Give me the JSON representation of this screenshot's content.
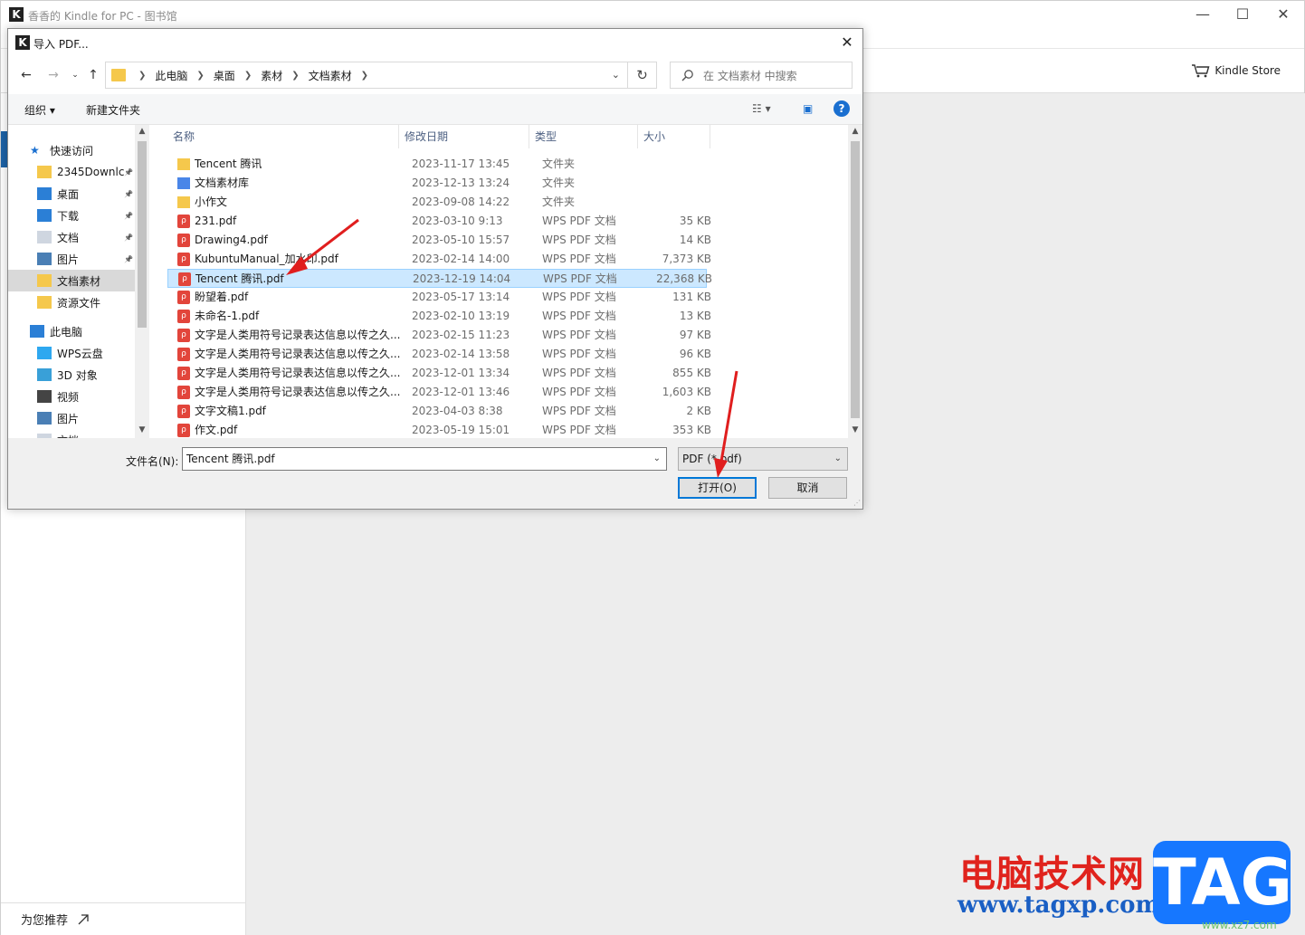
{
  "kindle": {
    "window_title": "香香的 Kindle for PC - 图书馆",
    "store_label": "Kindle Store",
    "recommend_label": "为您推荐",
    "icons": {
      "store": "cart-icon",
      "recommend": "external-link-icon"
    }
  },
  "dialog": {
    "title": "导入 PDF...",
    "breadcrumb": [
      "此电脑",
      "桌面",
      "素材",
      "文档素材"
    ],
    "search_placeholder": "在 文档素材 中搜索",
    "organize_label": "组织 ▾",
    "new_folder_label": "新建文件夹",
    "columns": [
      "名称",
      "修改日期",
      "类型",
      "大小"
    ],
    "nav": [
      {
        "label": "快速访问",
        "icon": "star-icon",
        "pinned": false
      },
      {
        "label": "2345Downlc",
        "icon": "folder-icon",
        "pinned": true
      },
      {
        "label": "桌面",
        "icon": "desktop-icon",
        "pinned": true
      },
      {
        "label": "下载",
        "icon": "download-icon",
        "pinned": true
      },
      {
        "label": "文档",
        "icon": "document-icon",
        "pinned": true
      },
      {
        "label": "图片",
        "icon": "pictures-icon",
        "pinned": true
      },
      {
        "label": "文档素材",
        "icon": "folder-icon",
        "pinned": false,
        "selected": true
      },
      {
        "label": "资源文件",
        "icon": "folder-icon",
        "pinned": false
      },
      {
        "label": "此电脑",
        "icon": "computer-icon",
        "pinned": false
      },
      {
        "label": "WPS云盘",
        "icon": "cloud-icon",
        "pinned": false
      },
      {
        "label": "3D 对象",
        "icon": "cube-icon",
        "pinned": false
      },
      {
        "label": "视频",
        "icon": "video-icon",
        "pinned": false
      },
      {
        "label": "图片",
        "icon": "pictures-icon",
        "pinned": false
      },
      {
        "label": "文档",
        "icon": "document-icon",
        "pinned": false
      }
    ],
    "files": [
      {
        "name": "Tencent 腾讯",
        "date": "2023-11-17 13:45",
        "type": "文件夹",
        "size": "",
        "kind": "folder"
      },
      {
        "name": "文档素材库",
        "date": "2023-12-13 13:24",
        "type": "文件夹",
        "size": "",
        "kind": "lib"
      },
      {
        "name": "小作文",
        "date": "2023-09-08 14:22",
        "type": "文件夹",
        "size": "",
        "kind": "folder"
      },
      {
        "name": "231.pdf",
        "date": "2023-03-10 9:13",
        "type": "WPS PDF 文档",
        "size": "35 KB",
        "kind": "pdf"
      },
      {
        "name": "Drawing4.pdf",
        "date": "2023-05-10 15:57",
        "type": "WPS PDF 文档",
        "size": "14 KB",
        "kind": "pdf"
      },
      {
        "name": "KubuntuManual_加水印.pdf",
        "date": "2023-02-14 14:00",
        "type": "WPS PDF 文档",
        "size": "7,373 KB",
        "kind": "pdf"
      },
      {
        "name": "Tencent 腾讯.pdf",
        "date": "2023-12-19 14:04",
        "type": "WPS PDF 文档",
        "size": "22,368 KB",
        "kind": "pdf",
        "selected": true
      },
      {
        "name": "盼望着.pdf",
        "date": "2023-05-17 13:14",
        "type": "WPS PDF 文档",
        "size": "131 KB",
        "kind": "pdf"
      },
      {
        "name": "未命名-1.pdf",
        "date": "2023-02-10 13:19",
        "type": "WPS PDF 文档",
        "size": "13 KB",
        "kind": "pdf"
      },
      {
        "name": "文字是人类用符号记录表达信息以传之久...",
        "date": "2023-02-15 11:23",
        "type": "WPS PDF 文档",
        "size": "97 KB",
        "kind": "pdf"
      },
      {
        "name": "文字是人类用符号记录表达信息以传之久...",
        "date": "2023-02-14 13:58",
        "type": "WPS PDF 文档",
        "size": "96 KB",
        "kind": "pdf"
      },
      {
        "name": "文字是人类用符号记录表达信息以传之久...",
        "date": "2023-12-01 13:34",
        "type": "WPS PDF 文档",
        "size": "855 KB",
        "kind": "pdf"
      },
      {
        "name": "文字是人类用符号记录表达信息以传之久...",
        "date": "2023-12-01 13:46",
        "type": "WPS PDF 文档",
        "size": "1,603 KB",
        "kind": "pdf"
      },
      {
        "name": "文字文稿1.pdf",
        "date": "2023-04-03 8:38",
        "type": "WPS PDF 文档",
        "size": "2 KB",
        "kind": "pdf"
      },
      {
        "name": "作文.pdf",
        "date": "2023-05-19 15:01",
        "type": "WPS PDF 文档",
        "size": "353 KB",
        "kind": "pdf"
      }
    ],
    "filename_label": "文件名(N):",
    "filename_value": "Tencent 腾讯.pdf",
    "filter_value": "PDF (*.pdf)",
    "open_label": "打开(O)",
    "cancel_label": "取消"
  },
  "watermark": {
    "cn": "电脑技术网",
    "url": "www.tagxp.com",
    "tag": "TAG",
    "small": "www.xz7.com"
  },
  "colors": {
    "accent": "#0078d7",
    "selection": "#cce8ff",
    "arrow": "#e01e1e",
    "pdf": "#e2453b",
    "folder": "#f5c84c"
  }
}
